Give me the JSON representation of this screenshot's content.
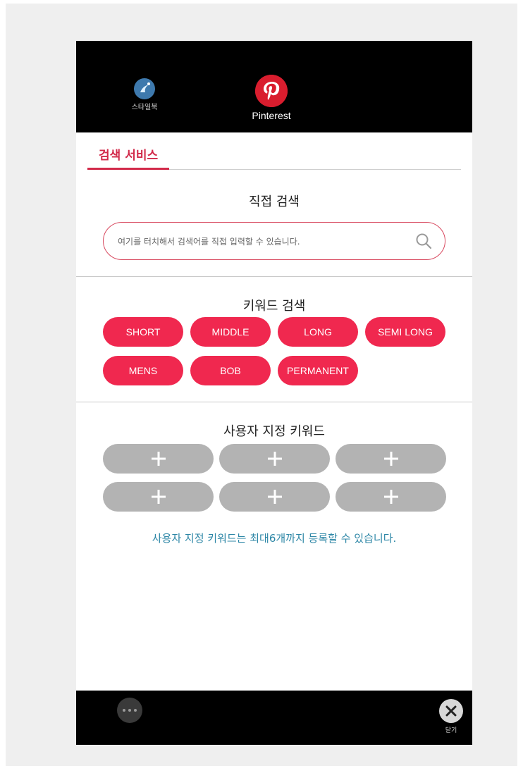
{
  "top_apps": [
    {
      "label": "스타일북",
      "icon": "stylebook-icon"
    },
    {
      "label": "Pinterest",
      "icon": "pinterest-icon"
    }
  ],
  "tabs": {
    "active": "검색 서비스"
  },
  "direct_search": {
    "title": "직접 검색",
    "placeholder": "여기를 터치해서 검색어를 직접 입력할 수 있습니다."
  },
  "keyword_search": {
    "title": "키워드 검색",
    "keywords": [
      "SHORT",
      "MIDDLE",
      "LONG",
      "SEMI LONG",
      "MENS",
      "BOB",
      "PERMANENT"
    ]
  },
  "custom_keywords": {
    "title": "사용자 지정 키워드",
    "note": "사용자 지정 키워드는 최대6개까지 등록할 수 있습니다."
  },
  "bottom_bar": {
    "close_label": "닫기"
  },
  "colors": {
    "accent": "#f0284f",
    "tab_accent": "#d22a4a",
    "note": "#2c86a6",
    "plus_button": "#b3b3b3"
  }
}
